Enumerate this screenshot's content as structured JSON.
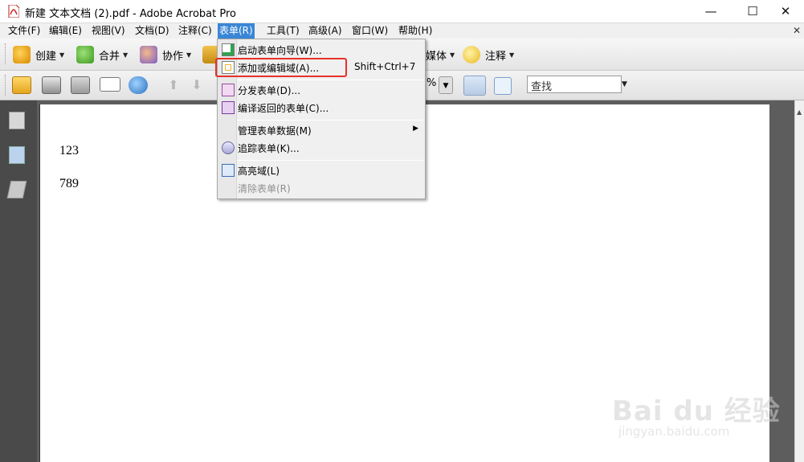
{
  "window": {
    "title": "新建 文本文档 (2).pdf - Adobe Acrobat Pro",
    "controls": {
      "minimize": "—",
      "maximize": "☐",
      "close": "✕"
    }
  },
  "menubar": {
    "items": [
      {
        "label": "文件(F)"
      },
      {
        "label": "编辑(E)"
      },
      {
        "label": "视图(V)"
      },
      {
        "label": "文档(D)"
      },
      {
        "label": "注释(C)"
      },
      {
        "label": "表单(R)",
        "active": true
      },
      {
        "label": "工具(T)"
      },
      {
        "label": "高级(A)"
      },
      {
        "label": "窗口(W)"
      },
      {
        "label": "帮助(H)"
      }
    ],
    "close": "✕"
  },
  "toolbar1": {
    "create": "创建",
    "combine": "合并",
    "collaborate": "协作",
    "media": "媒体",
    "comment": "注释"
  },
  "toolbar2": {
    "zoom_suffix": "%",
    "search_placeholder": "查找"
  },
  "form_menu": {
    "items": [
      {
        "label": "启动表单向导(W)...",
        "shortcut": "",
        "icon": "form-wizard-icon"
      },
      {
        "label": "添加或编辑域(A)...",
        "shortcut": "Shift+Ctrl+7",
        "icon": "edit-field-icon",
        "highlighted": true
      },
      {
        "label": "分发表单(D)...",
        "shortcut": "",
        "icon": "distribute-form-icon"
      },
      {
        "label": "编译返回的表单(C)...",
        "shortcut": "",
        "icon": "compile-form-icon"
      },
      {
        "label": "管理表单数据(M)",
        "shortcut": "",
        "icon": "",
        "submenu": true
      },
      {
        "label": "追踪表单(K)...",
        "shortcut": "",
        "icon": "track-form-icon"
      },
      {
        "label": "高亮域(L)",
        "shortcut": "",
        "icon": "highlight-fields-icon"
      },
      {
        "label": "清除表单(R)",
        "shortcut": "",
        "icon": "",
        "disabled": true
      }
    ]
  },
  "document": {
    "lines": [
      "123",
      "789"
    ]
  },
  "watermark": {
    "main": "Bai du 经验",
    "sub": "jingyan.baidu.com"
  },
  "colors": {
    "menu_active": "#3a86d6",
    "highlight_border": "#e8312a",
    "left_panel": "#4a4a4a",
    "doc_background": "#5d5d5d"
  }
}
